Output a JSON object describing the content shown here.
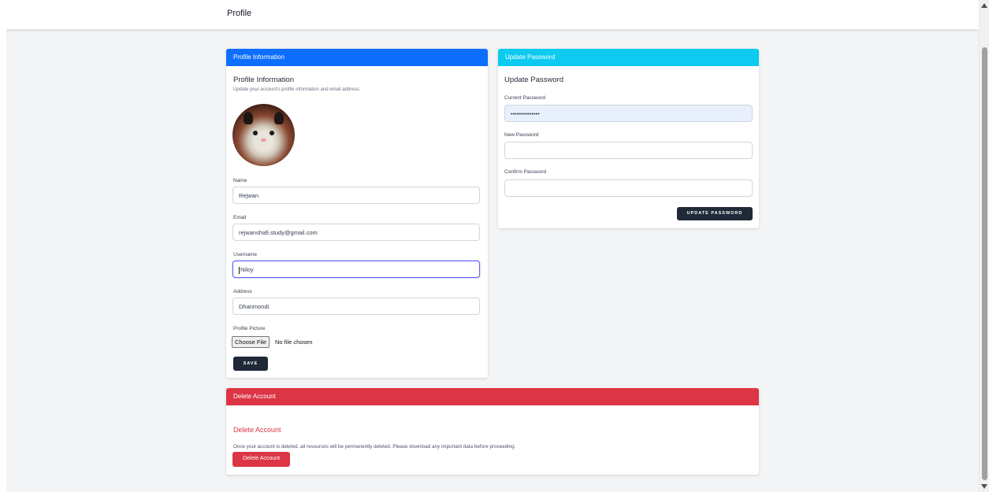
{
  "header": {
    "title": "Profile"
  },
  "profile_card": {
    "header": "Profile Information",
    "title": "Profile Information",
    "description": "Update your account's profile information and email address.",
    "fields": {
      "name": {
        "label": "Name",
        "value": "Rejwan"
      },
      "email": {
        "label": "Email",
        "value": "rejwanshafi.study@gmail.com"
      },
      "username": {
        "label": "Username",
        "value": "Niloy"
      },
      "address": {
        "label": "Address",
        "value": "Dhanmondi"
      }
    },
    "picture": {
      "label": "Profile Picture",
      "button": "Choose File",
      "status": "No file chosen"
    },
    "save_label": "SAVE"
  },
  "password_card": {
    "header": "Update Password",
    "title": "Update Password",
    "current_label": "Current Password",
    "current_value": "••••••••••••••",
    "new_label": "New Password",
    "new_value": "",
    "confirm_label": "Confirm Password",
    "confirm_value": "",
    "button": "UPDATE PASSWORD"
  },
  "delete_card": {
    "header": "Delete Account",
    "title": "Delete Account",
    "description": "Once your account is deleted, all resources will be permanently deleted. Please download any important data before proceeding.",
    "button": "Delete Account"
  },
  "colors": {
    "primary": "#0d6efd",
    "info": "#0dcaf0",
    "danger": "#dc3545",
    "dark": "#1f2937"
  }
}
